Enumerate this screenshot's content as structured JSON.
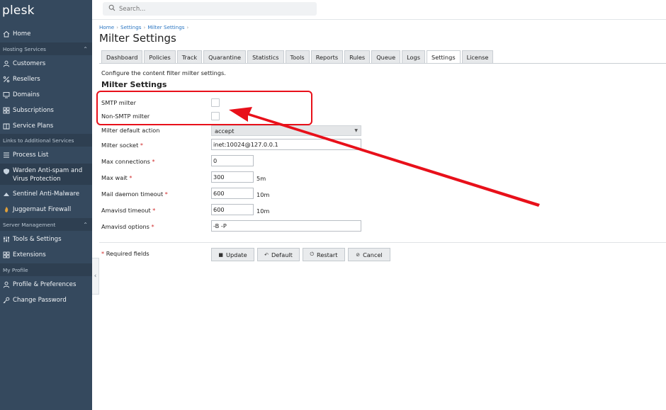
{
  "app": {
    "logo": "plesk"
  },
  "sidebar": {
    "home": "Home",
    "sections": {
      "hosting": "Hosting Services",
      "links": "Links to Additional Services",
      "server": "Server Management",
      "profile": "My Profile"
    },
    "items": {
      "customers": "Customers",
      "resellers": "Resellers",
      "domains": "Domains",
      "subscriptions": "Subscriptions",
      "service_plans": "Service Plans",
      "process_list": "Process List",
      "warden_line1": "Warden Anti-spam and",
      "warden_line2": "Virus Protection",
      "sentinel": "Sentinel Anti-Malware",
      "juggernaut": "Juggernaut Firewall",
      "tools": "Tools & Settings",
      "extensions": "Extensions",
      "profile_prefs": "Profile & Preferences",
      "change_password": "Change Password"
    }
  },
  "search": {
    "placeholder": "Search..."
  },
  "breadcrumb": [
    "Home",
    "Settings",
    "Milter Settings"
  ],
  "page_title": "Milter Settings",
  "tabs": [
    "Dashboard",
    "Policies",
    "Track",
    "Quarantine",
    "Statistics",
    "Tools",
    "Reports",
    "Rules",
    "Queue",
    "Logs",
    "Settings",
    "License"
  ],
  "active_tab": "Settings",
  "description": "Configure the content filter milter settings.",
  "section_title": "Milter Settings",
  "form": {
    "smtp_milter": "SMTP milter",
    "non_smtp_milter": "Non-SMTP milter",
    "default_action_label": "Milter default action",
    "default_action_value": "accept",
    "socket_label": "Milter socket",
    "socket_value": "inet:10024@127.0.0.1",
    "max_connections_label": "Max connections",
    "max_connections_value": "0",
    "max_wait_label": "Max wait",
    "max_wait_value": "300",
    "max_wait_unit": "5m",
    "mail_daemon_label": "Mail daemon timeout",
    "mail_daemon_value": "600",
    "mail_daemon_unit": "10m",
    "amavisd_timeout_label": "Amavisd timeout",
    "amavisd_timeout_value": "600",
    "amavisd_timeout_unit": "10m",
    "amavisd_options_label": "Amavisd options",
    "amavisd_options_value": "-B -P",
    "required_marker": "*"
  },
  "required_note": "Required fields",
  "buttons": {
    "update": "Update",
    "default": "Default",
    "restart": "Restart",
    "cancel": "Cancel"
  },
  "colors": {
    "sidebar": "#35495e",
    "annotation": "#e8101a",
    "link": "#2b76c2"
  }
}
